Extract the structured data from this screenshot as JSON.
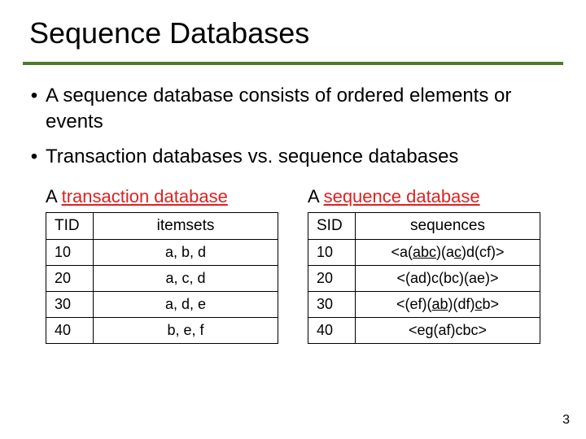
{
  "title": "Sequence Databases",
  "bullets": [
    "A sequence database consists of ordered elements or events",
    "Transaction databases vs. sequence databases"
  ],
  "left": {
    "caption_prefix": "A ",
    "caption_red": "transaction database",
    "headers": [
      "TID",
      "itemsets"
    ],
    "rows": [
      [
        "10",
        "a, b, d"
      ],
      [
        "20",
        "a, c, d"
      ],
      [
        "30",
        "a, d, e"
      ],
      [
        "40",
        "b, e, f"
      ]
    ]
  },
  "right": {
    "caption_prefix": "A ",
    "caption_red": "sequence database",
    "headers": [
      "SID",
      "sequences"
    ],
    "rows": [
      {
        "id": "10",
        "seq": [
          "<a(",
          {
            "u": "abc"
          },
          ")(a",
          {
            "u": "c"
          },
          ")d(cf)>"
        ]
      },
      {
        "id": "20",
        "seq": [
          "<(ad)c(bc)(ae)>"
        ]
      },
      {
        "id": "30",
        "seq": [
          "<(ef)(",
          {
            "u": "ab"
          },
          ")(df)",
          {
            "u": "c"
          },
          "b>"
        ]
      },
      {
        "id": "40",
        "seq": [
          "<eg(af)cbc>"
        ]
      }
    ]
  },
  "page_number": "3"
}
